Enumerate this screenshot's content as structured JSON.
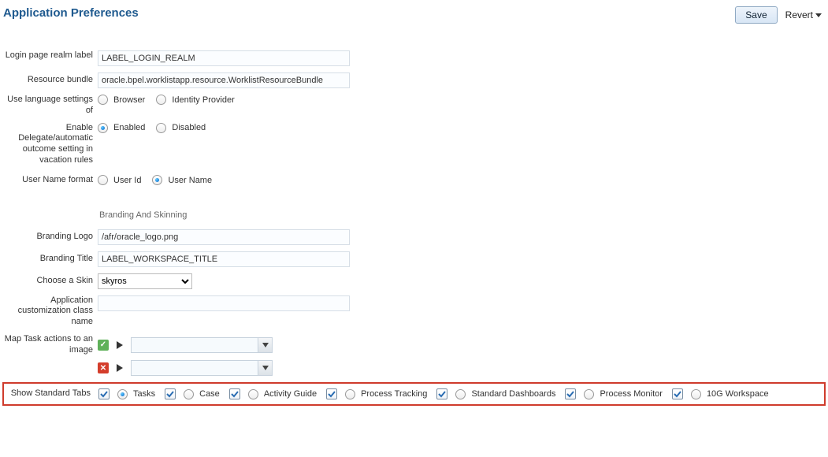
{
  "page_title": "Application Preferences",
  "actions": {
    "save": "Save",
    "revert": "Revert"
  },
  "fields": {
    "login_realm": {
      "label": "Login page realm label",
      "value": "LABEL_LOGIN_REALM"
    },
    "resource_bundle": {
      "label": "Resource bundle",
      "value": "oracle.bpel.worklistapp.resource.WorklistResourceBundle"
    },
    "use_lang": {
      "label": "Use language settings of",
      "options": [
        "Browser",
        "Identity Provider"
      ],
      "selected": null
    },
    "enable_delegate": {
      "label": "Enable Delegate/automatic outcome setting in vacation rules",
      "options": [
        "Enabled",
        "Disabled"
      ],
      "selected": "Enabled"
    },
    "username_format": {
      "label": "User Name format",
      "options": [
        "User Id",
        "User Name"
      ],
      "selected": "User Name"
    }
  },
  "branding": {
    "section": "Branding And Skinning",
    "logo": {
      "label": "Branding Logo",
      "value": "/afr/oracle_logo.png"
    },
    "title": {
      "label": "Branding Title",
      "value": "LABEL_WORKSPACE_TITLE"
    },
    "skin": {
      "label": "Choose a Skin",
      "value": "skyros"
    },
    "custom_class": {
      "label": "Application customization class name",
      "value": ""
    },
    "map_actions": {
      "label": "Map Task actions to an image"
    }
  },
  "tabs": {
    "label": "Show Standard Tabs",
    "items": [
      {
        "name": "Tasks",
        "checked": true,
        "default": true
      },
      {
        "name": "Case",
        "checked": true,
        "default": false
      },
      {
        "name": "Activity Guide",
        "checked": true,
        "default": false
      },
      {
        "name": "Process Tracking",
        "checked": true,
        "default": false
      },
      {
        "name": "Standard Dashboards",
        "checked": true,
        "default": false
      },
      {
        "name": "Process Monitor",
        "checked": true,
        "default": false
      },
      {
        "name": "10G Workspace",
        "checked": true,
        "default": false
      }
    ]
  }
}
